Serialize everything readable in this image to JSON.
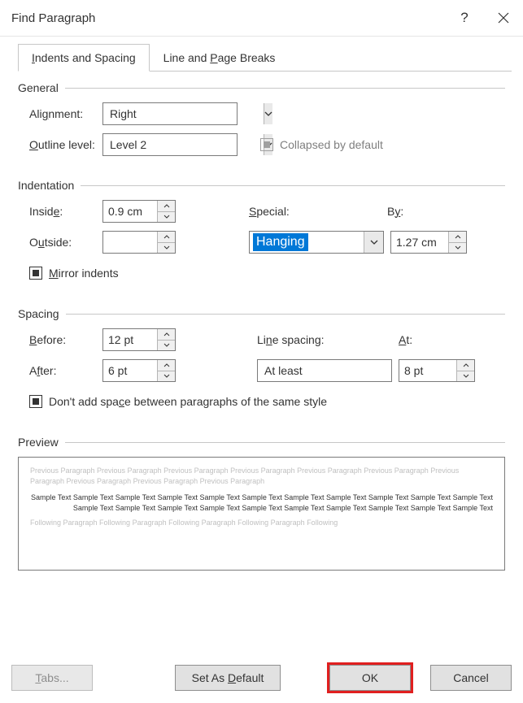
{
  "title": "Find Paragraph",
  "tabs": {
    "t1": "Indents and Spacing",
    "t2": "Line and Page Breaks"
  },
  "general": {
    "title": "General",
    "alignment_label": "Alignment:",
    "alignment_value": "Right",
    "outline_label": "Outline level:",
    "outline_value": "Level 2",
    "collapsed_label": "Collapsed by default"
  },
  "indent": {
    "title": "Indentation",
    "inside_label": "Inside:",
    "inside_value": "0.9 cm",
    "outside_label": "Outside:",
    "outside_value": "",
    "special_label": "Special:",
    "special_value": "Hanging",
    "by_label": "By:",
    "by_value": "1.27 cm",
    "mirror_label": "Mirror indents"
  },
  "spacing": {
    "title": "Spacing",
    "before_label": "Before:",
    "before_value": "12 pt",
    "after_label": "After:",
    "after_value": "6 pt",
    "linesp_label": "Line spacing:",
    "linesp_value": "At least",
    "at_label": "At:",
    "at_value": "8 pt",
    "dontadd_label": "Don't add space between paragraphs of the same style"
  },
  "preview": {
    "title": "Preview",
    "prev": "Previous Paragraph Previous Paragraph Previous Paragraph Previous Paragraph Previous Paragraph Previous Paragraph Previous Paragraph Previous Paragraph Previous Paragraph Previous Paragraph",
    "sample": "Sample Text Sample Text Sample Text Sample Text Sample Text Sample Text Sample Text Sample Text Sample Text Sample Text Sample Text Sample Text Sample Text Sample Text Sample Text Sample Text Sample Text Sample Text Sample Text Sample Text Sample Text",
    "follow": "Following Paragraph Following Paragraph Following Paragraph Following Paragraph Following"
  },
  "footer": {
    "tabs": "Tabs...",
    "default": "Set As Default",
    "ok": "OK",
    "cancel": "Cancel"
  }
}
